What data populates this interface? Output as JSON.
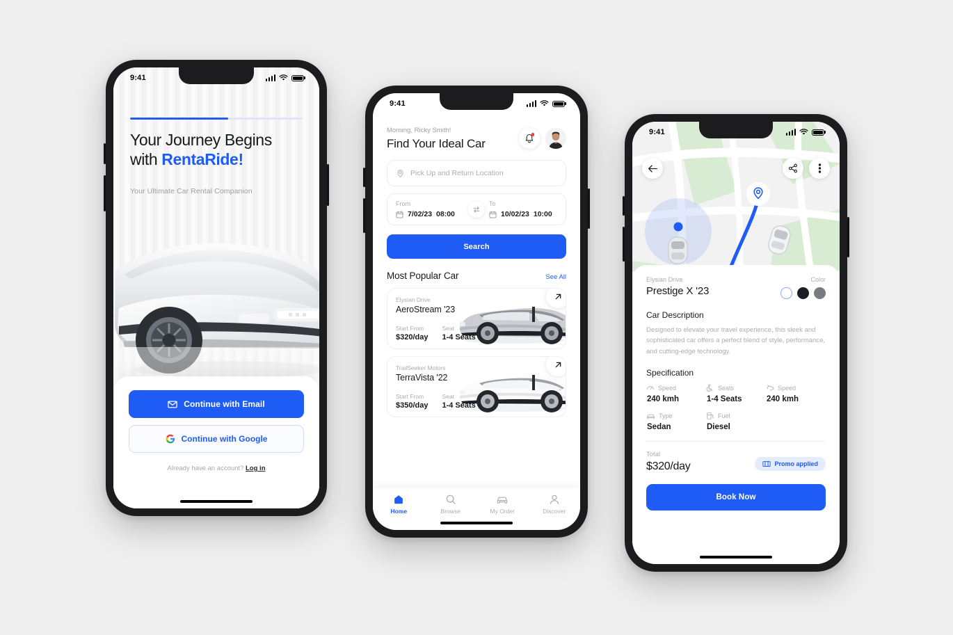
{
  "theme": {
    "accent": "#1f5bf5",
    "page_bg": "#efefef",
    "muted": "#a9adb4"
  },
  "phone1": {
    "status": {
      "time": "9:41",
      "signal_icon": "cellular-bars-icon",
      "wifi_icon": "wifi-icon",
      "battery_icon": "battery-icon"
    },
    "progress_percent": 57,
    "title_line1": "Your Journey Begins",
    "title_line2_prefix": "with ",
    "title_brand": "RentaRide!",
    "subtitle": "Your Ultimate Car Rental Companion",
    "hero_image": "silver-electric-car-photo",
    "email_button": {
      "label": "Continue with Email",
      "icon": "envelope-icon"
    },
    "google_button": {
      "label": "Continue with Google",
      "icon": "google-g-icon"
    },
    "footer_text": "Already have an account?",
    "login_link": "Log in"
  },
  "phone2": {
    "status": {
      "time": "9:41"
    },
    "greeting": "Morning, Ricky Smith!",
    "heading": "Find Your Ideal Car",
    "bell_icon": "bell-icon",
    "avatar": "user-avatar-photo",
    "location_field": {
      "placeholder": "Pick Up and Return Location",
      "icon": "map-pin-icon"
    },
    "from": {
      "label": "From",
      "date": "7/02/23",
      "time": "08:00",
      "icon": "calendar-icon"
    },
    "to": {
      "label": "To",
      "date": "10/02/23",
      "time": "10:00",
      "icon": "calendar-icon"
    },
    "swap_icon": "swap-arrows-icon",
    "search_button": "Search",
    "section_title": "Most Popular Car",
    "see_all": "See All",
    "cars": [
      {
        "brand": "Elysian Drive",
        "name": "AeroStream '23",
        "price_label": "Start From",
        "price": "$320/day",
        "seat_label": "Seat",
        "seats": "1-4 Seats",
        "image": "silver-suv-side-view",
        "go_icon": "arrow-up-right-icon"
      },
      {
        "brand": "TrailSeeker Motors",
        "name": "TerraVista '22",
        "price_label": "Start From",
        "price": "$350/day",
        "seat_label": "Seat",
        "seats": "1-4 Seats",
        "image": "white-suv-side-view",
        "go_icon": "arrow-up-right-icon"
      }
    ],
    "nav": [
      {
        "label": "Home",
        "icon": "home-icon",
        "active": true
      },
      {
        "label": "Browse",
        "icon": "search-icon",
        "active": false
      },
      {
        "label": "My Order",
        "icon": "car-icon",
        "active": false
      },
      {
        "label": "Discover",
        "icon": "person-icon",
        "active": false
      }
    ]
  },
  "phone3": {
    "status": {
      "time": "9:41"
    },
    "map": {
      "back_icon": "arrow-left-icon",
      "share_icon": "share-icon",
      "more_icon": "more-vertical-icon",
      "destination_icon": "location-pin-icon",
      "user_location": "blue-dot-with-radius",
      "route_color": "#1f5bf5"
    },
    "brand": "Elysian Drive",
    "name": "Prestige X '23",
    "color_label": "Color",
    "colors": [
      {
        "name": "white",
        "hex": "#ffffff",
        "selected": true
      },
      {
        "name": "black",
        "hex": "#1a1d21",
        "selected": false
      },
      {
        "name": "gray",
        "hex": "#787c80",
        "selected": false
      }
    ],
    "description_title": "Car Description",
    "description": "Designed to elevate your travel experience, this sleek and sophisticated car offers a perfect blend of style, performance, and cutting-edge technology.",
    "specification_title": "Specification",
    "specs": [
      {
        "label": "Speed",
        "value": "240 kmh",
        "icon": "speedometer-icon"
      },
      {
        "label": "Seats",
        "value": "1-4 Seats",
        "icon": "seat-icon"
      },
      {
        "label": "Speed",
        "value": "240 kmh",
        "icon": "engine-icon"
      },
      {
        "label": "Type",
        "value": "Sedan",
        "icon": "car-icon"
      },
      {
        "label": "Fuel",
        "value": "Diesel",
        "icon": "fuel-pump-icon"
      }
    ],
    "total_label": "Total",
    "total_value": "$320/day",
    "promo": {
      "label": "Promo applied",
      "icon": "ticket-icon"
    },
    "book_button": "Book Now"
  }
}
